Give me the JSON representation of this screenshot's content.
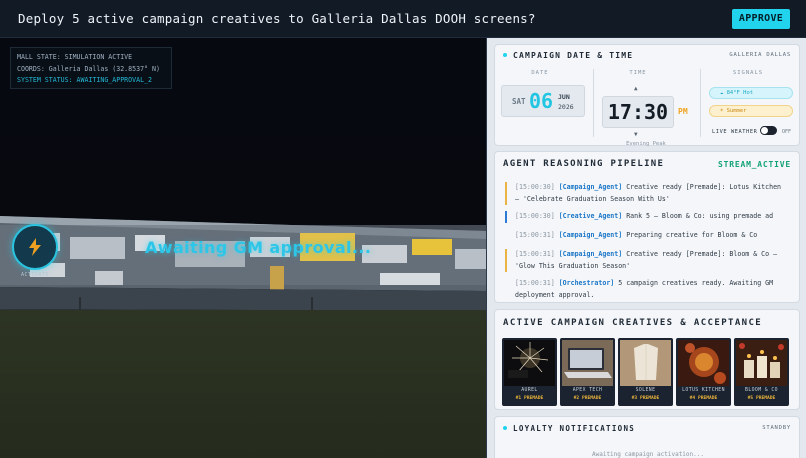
{
  "header": {
    "title": "Deploy 5 active campaign creatives to Galleria Dallas DOOH screens?",
    "approve_label": "APPROVE"
  },
  "scene": {
    "status_lines": [
      "MALL STATE: SIMULATION ACTIVE",
      "COORDS: Galleria Dallas (32.8537° N)",
      "SYSTEM STATUS: AWAITING_APPROVAL_2"
    ],
    "overlay_text": "Awaiting GM approval...",
    "activate_label": "ACTIVATE"
  },
  "datetime": {
    "title": "CAMPAIGN DATE & TIME",
    "location": "GALLERIA DALLAS",
    "date_label": "DATE",
    "time_label": "TIME",
    "signals_label": "SIGNALS",
    "dow": "SAT",
    "day": "06",
    "month": "JUN",
    "year": "2026",
    "time": "17:30",
    "ampm": "PM",
    "period": "Evening Peak",
    "signals": [
      "84°F Hot",
      "Summer"
    ],
    "live_weather_label": "LIVE WEATHER",
    "toggle_state": "OFF"
  },
  "pipeline": {
    "title": "AGENT REASONING PIPELINE",
    "status": "STREAM_ACTIVE",
    "entries": [
      {
        "ts": "[15:00:30]",
        "agent": "[Campaign_Agent]",
        "msg": "Creative ready [Premade]: Lotus Kitchen — 'Celebrate Graduation Season With Us'",
        "accent": "yellow"
      },
      {
        "ts": "[15:00:30]",
        "agent": "[Creative_Agent]",
        "msg": "Rank 5 — Bloom & Co: using premade ad",
        "accent": "blue"
      },
      {
        "ts": "[15:00:31]",
        "agent": "[Campaign_Agent]",
        "msg": "Preparing creative for Bloom & Co",
        "accent": "none"
      },
      {
        "ts": "[15:00:31]",
        "agent": "[Campaign_Agent]",
        "msg": "Creative ready [Premade]: Bloom & Co — 'Glow This Graduation Season'",
        "accent": "yellow"
      },
      {
        "ts": "[15:00:31]",
        "agent": "[Orchestrator]",
        "msg": "5 campaign creatives ready. Awaiting GM deployment approval.",
        "accent": "none"
      }
    ]
  },
  "creatives": {
    "title": "ACTIVE CAMPAIGN CREATIVES & ACCEPTANCE",
    "items": [
      {
        "name": "AUREL",
        "rank": "#1 PREMADE"
      },
      {
        "name": "APEX TECH",
        "rank": "#2 PREMADE"
      },
      {
        "name": "SOLENE",
        "rank": "#3 PREMADE"
      },
      {
        "name": "LOTUS KITCHEN",
        "rank": "#4 PREMADE"
      },
      {
        "name": "BLOOM & CO",
        "rank": "#5 PREMADE"
      }
    ]
  },
  "loyalty": {
    "title": "LOYALTY NOTIFICATIONS",
    "status": "STANDBY",
    "empty_text": "Awaiting campaign activation..."
  },
  "colors": {
    "accent": "#22d3ee",
    "stream": "#14a374",
    "premade": "#e8b23b"
  }
}
